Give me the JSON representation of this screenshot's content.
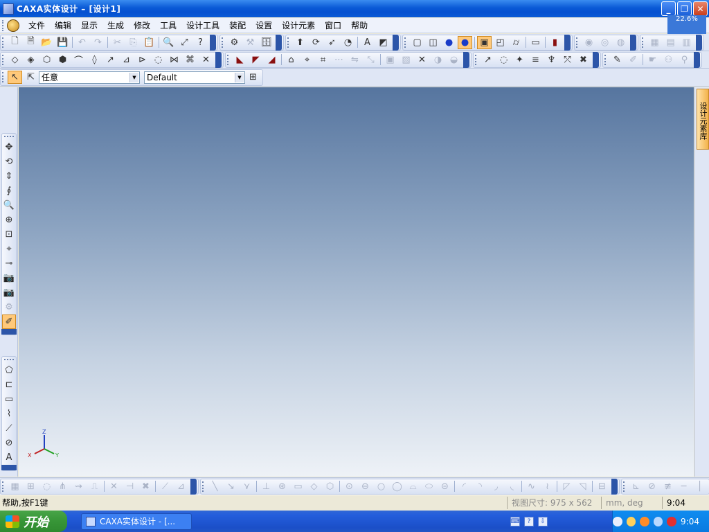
{
  "window": {
    "title": "CAXA实体设计 – [设计1]",
    "zoom": "22.6%"
  },
  "menu": {
    "items": [
      "文件",
      "编辑",
      "显示",
      "生成",
      "修改",
      "工具",
      "设计工具",
      "装配",
      "设置",
      "设计元素",
      "窗口",
      "帮助"
    ]
  },
  "selector": {
    "filter_value": "任意",
    "config_value": "Default"
  },
  "viewport": {
    "axis_x": "X",
    "axis_y": "Y",
    "axis_z": "Z"
  },
  "right_panel": {
    "tab_label": "设计元素库"
  },
  "status": {
    "help_text": "帮助,按F1键",
    "view_size": "视图尺寸: 975 x 562",
    "units": "mm, deg",
    "time": "9:04"
  },
  "taskbar": {
    "start_label": "开始",
    "task_title": "CAXA实体设计 - [...",
    "clock": "9:04"
  },
  "colors": {
    "title_bar": "#0a5ad6",
    "viewport_top": "#56759f",
    "viewport_bottom": "#eef2f7",
    "taskbar": "#245edc",
    "start_button": "#379537"
  }
}
